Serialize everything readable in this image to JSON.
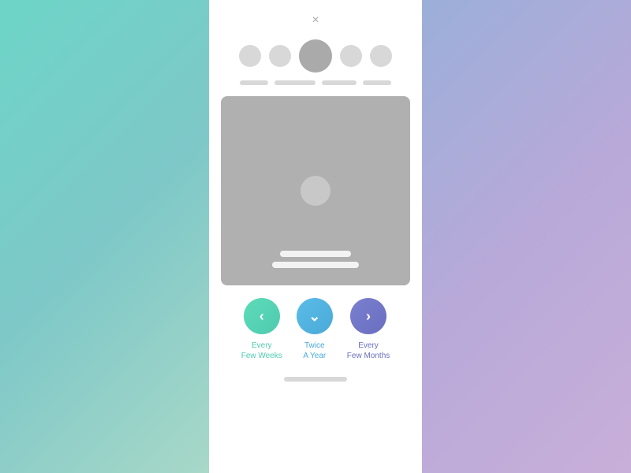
{
  "background": {
    "left_gradient": "linear-gradient(135deg, #6dd5c8, #a8d8c8)",
    "right_gradient": "linear-gradient(135deg, #9bafd9, #c8afd9)"
  },
  "modal": {
    "close_label": "×"
  },
  "dots": [
    {
      "size": "small"
    },
    {
      "size": "small"
    },
    {
      "size": "large"
    },
    {
      "size": "small"
    },
    {
      "size": "small"
    }
  ],
  "options": [
    {
      "id": "every-few-weeks",
      "icon": "‹",
      "color": "teal",
      "label_line1": "Every",
      "label_line2": "Few Weeks"
    },
    {
      "id": "twice-a-year",
      "icon": "˅",
      "color": "blue",
      "label_line1": "Twice",
      "label_line2": "A Year"
    },
    {
      "id": "every-few-months",
      "icon": "›",
      "color": "purple",
      "label_line1": "Every",
      "label_line2": "Few Months"
    }
  ]
}
